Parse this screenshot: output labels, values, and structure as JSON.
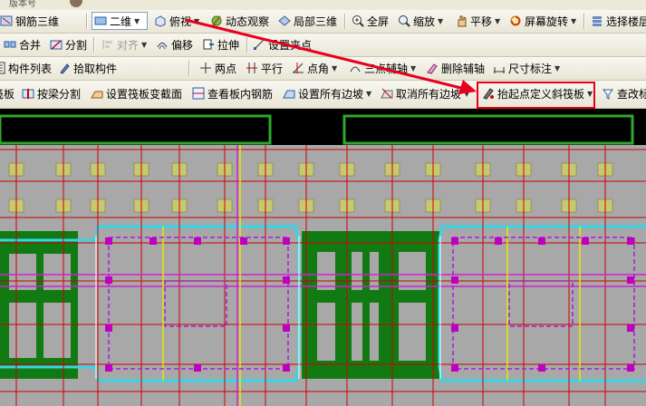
{
  "titlebar": {
    "version_text": "版本号"
  },
  "toolbar1": {
    "steel_3d": "钢筋三维",
    "view_2d": "二维",
    "top_view": "俯视",
    "dynamic_observe": "动态观察",
    "local_3d": "局部三维",
    "full_screen": "全屏",
    "zoom": "缩放",
    "pan": "平移",
    "screen_rotate": "屏幕旋转",
    "select_floor": "选择楼层"
  },
  "toolbar2": {
    "merge": "合并",
    "split": "分割",
    "align": "对齐",
    "offset": "偏移",
    "stretch": "拉伸",
    "set_clip_point": "设置夹点"
  },
  "toolbar3": {
    "component_list": "构件列表",
    "pick_component": "拾取构件",
    "two_points": "两点",
    "parallel": "平行",
    "point_angle": "点角",
    "three_point_aux": "三点辅轴",
    "delete_aux": "删除辅轴",
    "dimension": "尺寸标注"
  },
  "toolbar4": {
    "raft_slab": "筏板",
    "split_by_beam": "按梁分割",
    "set_raft_section": "设置筏板变截面",
    "view_slab_rebar": "查看板内钢筋",
    "set_all_slopes": "设置所有边坡",
    "cancel_all_slopes": "取消所有边坡",
    "pick_point_slope_raft": "抬起点定义斜筏板",
    "check_slab": "查改标"
  },
  "colors": {
    "annotation_red": "#e8001c",
    "canvas_bg": "#000000",
    "slab_gray": "#a8a8a8",
    "grid_red": "#d00000",
    "cyan_outline": "#2fd8e8",
    "green_fill": "#127a12",
    "magenta": "#d020d0",
    "yellow": "#e8e800"
  },
  "icons": [
    "steel-3d-icon",
    "view-2d-icon",
    "top-view-icon",
    "dynamic-observe-icon",
    "local-3d-icon",
    "full-screen-icon",
    "zoom-icon",
    "pan-icon",
    "rotate-icon",
    "select-floor-icon",
    "merge-icon",
    "split-icon",
    "align-icon",
    "offset-icon",
    "stretch-icon",
    "clip-point-icon",
    "list-icon",
    "pick-icon",
    "two-points-icon",
    "parallel-icon",
    "point-angle-icon",
    "three-point-icon",
    "delete-aux-icon",
    "dimension-icon",
    "raft-icon",
    "split-beam-icon",
    "section-icon",
    "view-rebar-icon",
    "slope-icon",
    "cancel-slope-icon",
    "slope-raft-icon",
    "check-icon"
  ]
}
